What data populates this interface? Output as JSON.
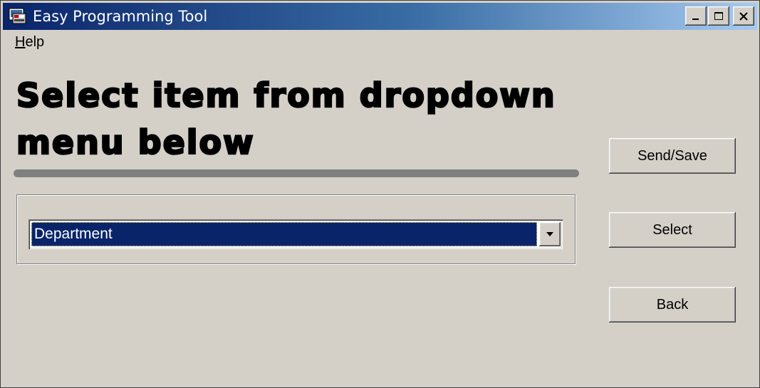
{
  "window": {
    "title": "Easy Programming Tool",
    "app_icon": "app-window-icon",
    "controls": [
      "minimize-icon",
      "maximize-icon",
      "close-icon"
    ],
    "titlebar_color_start": "#0a246a",
    "titlebar_color_end": "#a6caf0"
  },
  "menu": {
    "help_mnemonic": "H",
    "help_rest": "elp"
  },
  "heading": {
    "line1": "Select item from dropdown",
    "line2": "menu below"
  },
  "dropdown": {
    "selected": "Department",
    "arrow_icon": "chevron-down-icon",
    "selection_color": "#0a246a"
  },
  "buttons": {
    "send_save": "Send/Save",
    "select": "Select",
    "back": "Back"
  }
}
